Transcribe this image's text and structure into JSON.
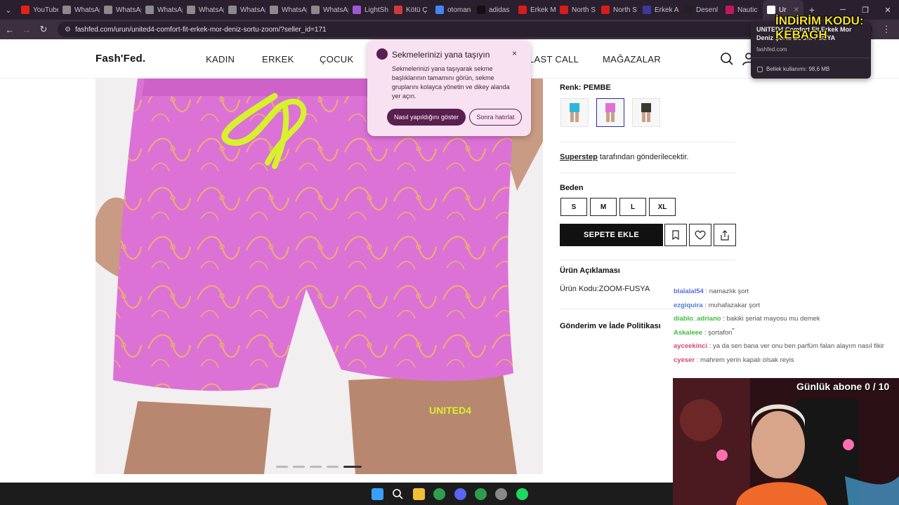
{
  "browser": {
    "tabs": [
      {
        "label": "YouTube",
        "color": "#e62117"
      },
      {
        "label": "WhatsApp",
        "color": "#8a8a8a"
      },
      {
        "label": "WhatsApp",
        "color": "#8a8a8a"
      },
      {
        "label": "WhatsApp",
        "color": "#8a8a8a"
      },
      {
        "label": "WhatsApp",
        "color": "#8a8a8a"
      },
      {
        "label": "WhatsApp",
        "color": "#8a8a8a"
      },
      {
        "label": "WhatsApp",
        "color": "#8a8a8a"
      },
      {
        "label": "WhatsApp",
        "color": "#8a8a8a"
      },
      {
        "label": "LightSh",
        "color": "#9b59d0"
      },
      {
        "label": "Kötü Ç",
        "color": "#d03a3a"
      },
      {
        "label": "otoman",
        "color": "#4285f4"
      },
      {
        "label": "adidas",
        "color": "#111111"
      },
      {
        "label": "Erkek M",
        "color": "#d81b1b"
      },
      {
        "label": "North S",
        "color": "#d81b1b"
      },
      {
        "label": "North S",
        "color": "#d81b1b"
      },
      {
        "label": "Erkek A",
        "color": "#3a3a9a"
      },
      {
        "label": "Desenl",
        "color": "#222222"
      },
      {
        "label": "Nautic",
        "color": "#c2185b"
      }
    ],
    "active_tab": {
      "label": "Ur"
    },
    "new_tab": "+",
    "url": "fashfed.com/urun/united4-comfort-fit-erkek-mor-deniz-sortu-zoom/?seller_id=171"
  },
  "site": {
    "logo": "Fash'Fed.",
    "nav": {
      "kadin": "KADIN",
      "erkek": "ERKEK",
      "cocuk": "ÇOCUK",
      "last_call": "LAST CALL",
      "magazalar": "MAĞAZALAR"
    }
  },
  "product": {
    "color_label": "Renk: PEMBE",
    "seller_name": "Superstep",
    "seller_suffix": " tarafından gönderilecektir.",
    "size_label": "Beden",
    "sizes": [
      "S",
      "M",
      "L",
      "XL"
    ],
    "add_to_cart": "SEPETE EKLE",
    "description_title": "Ürün Açıklaması",
    "product_code": "Ürün Kodu:ZOOM-FUSYA",
    "shipping_title": "Gönderim ve İade Politikası",
    "image_brand_print": "UNITED4",
    "active_image_index": 5,
    "image_count": 5
  },
  "popup": {
    "title": "Sekmelerinizi yana taşıyın",
    "body": "Sekmelerinizi yana taşıyarak sekme başlıklarının tamamını görün, sekme gruplarını kolayca yönetin ve dikey alanda yer açın.",
    "primary": "Nasıl yapıldığını göster",
    "secondary": "Sonra hatırlat",
    "close": "×"
  },
  "hovercard": {
    "title": "UNITED4 Comfort Fit Erkek Mor Deniz Şortu ZOOM-FUSYA",
    "domain": "fashfed.com",
    "memory": "Bellek kullanımı: 98,6 MB"
  },
  "stream": {
    "discount_overlay": "İNDİRİM KODU: KEBAGH",
    "sub_counter": "Günlük abone 0 / 10",
    "chat": [
      {
        "user": "blalalal54",
        "color": "#5b6fd6",
        "msg": "namazlık şort"
      },
      {
        "user": "ezgiquira",
        "color": "#4a7fd6",
        "msg": "muhafazakar şort"
      },
      {
        "user": "diablo_adriano",
        "color": "#3fbf3f",
        "msg": "bakiki şeriat mayosu mu demek"
      },
      {
        "user": "Askaleee",
        "color": "#3fbf3f",
        "msg": "şortafon"
      },
      {
        "user": "ayceekinci",
        "color": "#d6457a",
        "msg": "ya da sen bana ver onu ben parfüm falan alayım nasıl fikir"
      },
      {
        "user": "cyeser",
        "color": "#d6457a",
        "msg": "mahrem yerin kapalı olsak reyis"
      }
    ]
  }
}
